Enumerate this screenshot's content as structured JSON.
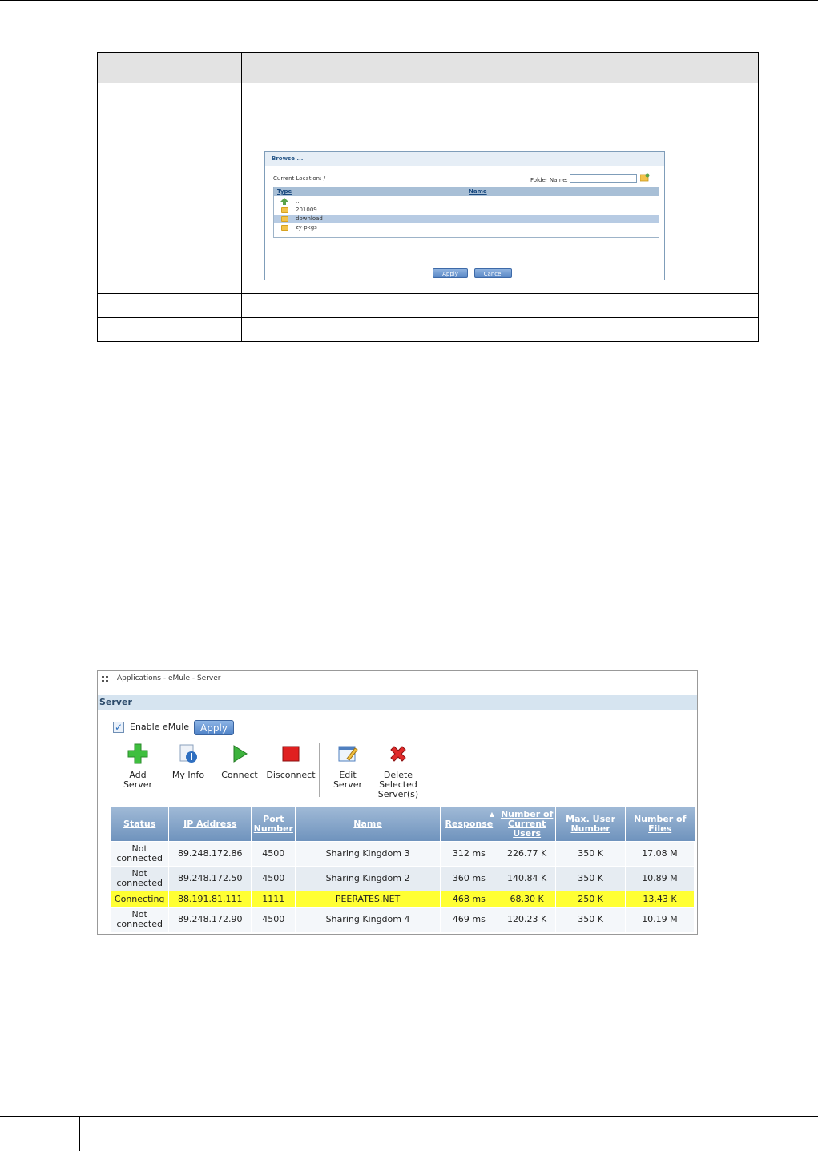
{
  "browse_dialog": {
    "title": "Browse ...",
    "current_location_label": "Current Location: /",
    "folder_name_label": "Folder Name:",
    "columns": [
      "Type",
      "Name"
    ],
    "rows": [
      "..",
      "201009",
      "download",
      "zy-pkgs"
    ],
    "selected_row": "download",
    "apply_label": "Apply",
    "cancel_label": "Cancel"
  },
  "emule": {
    "breadcrumb": "Applications - eMule - Server",
    "section_title": "Server",
    "enable_label": "Enable eMule",
    "enable_checked": true,
    "apply_label": "Apply",
    "toolbar": {
      "add": "Add Server",
      "myinfo": "My Info",
      "connect": "Connect",
      "disconnect": "Disconnect",
      "edit": "Edit Server",
      "delete": "Delete Selected Server(s)"
    },
    "columns": [
      "Status",
      "IP Address",
      "Port Number",
      "Name",
      "Response",
      "Number of Current Users",
      "Max. User Number",
      "Number of Files"
    ],
    "sort_column": "Response",
    "rows": [
      [
        "Not connected",
        "89.248.172.86",
        "4500",
        "Sharing Kingdom 3",
        "312 ms",
        "226.77 K",
        "350 K",
        "17.08 M"
      ],
      [
        "Not connected",
        "89.248.172.50",
        "4500",
        "Sharing Kingdom 2",
        "360 ms",
        "140.84 K",
        "350 K",
        "10.89 M"
      ],
      [
        "Connecting",
        "88.191.81.111",
        "1111",
        "PEERATES.NET",
        "468 ms",
        "68.30 K",
        "250 K",
        "13.43 K"
      ],
      [
        "Not connected",
        "89.248.172.90",
        "4500",
        "Sharing Kingdom 4",
        "469 ms",
        "120.23 K",
        "350 K",
        "10.19 M"
      ]
    ],
    "highlighted_row": 2,
    "colors": {
      "highlight": "#ffff33",
      "header": "#6f93bd"
    }
  }
}
